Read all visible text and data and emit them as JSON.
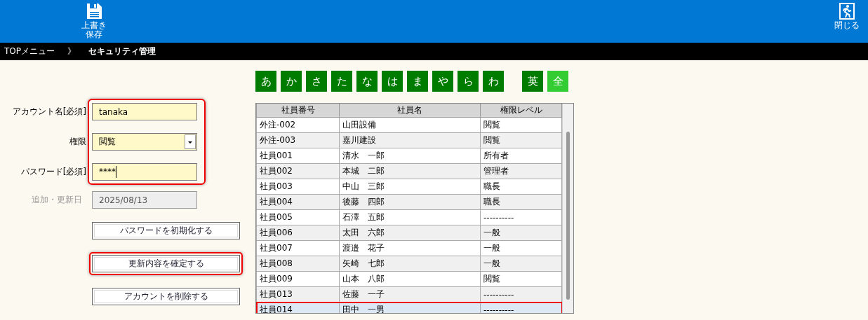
{
  "toolbar": {
    "save_button": {
      "label": "上書き保存"
    },
    "close_button": {
      "label": "閉じる"
    }
  },
  "breadcrumb": {
    "separator": "》",
    "items": [
      {
        "label": "TOPメニュー",
        "current": false
      },
      {
        "label": "セキュリティ管理",
        "current": true
      }
    ]
  },
  "form": {
    "highlighted": true,
    "fields": [
      {
        "label": "アカウント名[必須]",
        "kind": "text",
        "value": "tanaka",
        "disabled": false
      },
      {
        "label": "権限",
        "kind": "select",
        "value": "閲覧",
        "disabled": false
      },
      {
        "label": "パスワード[必須]",
        "kind": "password",
        "value": "****",
        "disabled": false
      }
    ],
    "date_field": {
      "label": "追加・更新日",
      "kind": "text",
      "value": "2025/08/13",
      "disabled": true
    }
  },
  "buttons": [
    {
      "label": "パスワードを初期化する",
      "highlighted": false
    },
    {
      "label": "更新内容を確定する",
      "highlighted": true
    },
    {
      "label": "アカウントを削除する",
      "highlighted": false
    }
  ],
  "kana_filter": [
    {
      "label": "あ",
      "selected": false
    },
    {
      "label": "か",
      "selected": false
    },
    {
      "label": "さ",
      "selected": false
    },
    {
      "label": "た",
      "selected": false
    },
    {
      "label": "な",
      "selected": false
    },
    {
      "label": "は",
      "selected": false
    },
    {
      "label": "ま",
      "selected": false
    },
    {
      "label": "や",
      "selected": false
    },
    {
      "label": "ら",
      "selected": false
    },
    {
      "label": "わ",
      "selected": false
    },
    {
      "label": "英",
      "selected": false
    },
    {
      "label": "全",
      "selected": true
    }
  ],
  "table": {
    "columns": [
      "社員番号",
      "社員名",
      "権限レベル"
    ],
    "rows": [
      {
        "cells": [
          "外注-002",
          "山田設備",
          "閲覧"
        ],
        "selected": false
      },
      {
        "cells": [
          "外注-003",
          "嘉川建設",
          "閲覧"
        ],
        "selected": false
      },
      {
        "cells": [
          "社員001",
          "清水　一郎",
          "所有者"
        ],
        "selected": false
      },
      {
        "cells": [
          "社員002",
          "本城　二郎",
          "管理者"
        ],
        "selected": false
      },
      {
        "cells": [
          "社員003",
          "中山　三郎",
          "職長"
        ],
        "selected": false
      },
      {
        "cells": [
          "社員004",
          "後藤　四郎",
          "職長"
        ],
        "selected": false
      },
      {
        "cells": [
          "社員005",
          "石澤　五郎",
          "----------"
        ],
        "selected": false
      },
      {
        "cells": [
          "社員006",
          "太田　六郎",
          "一般"
        ],
        "selected": false
      },
      {
        "cells": [
          "社員007",
          "渡邉　花子",
          "一般"
        ],
        "selected": false
      },
      {
        "cells": [
          "社員008",
          "矢崎　七郎",
          "一般"
        ],
        "selected": false
      },
      {
        "cells": [
          "社員009",
          "山本　八郎",
          "閲覧"
        ],
        "selected": false
      },
      {
        "cells": [
          "社員013",
          "佐藤　一子",
          "----------"
        ],
        "selected": false
      },
      {
        "cells": [
          "社員014",
          "田中　一男",
          "----------"
        ],
        "selected": true
      }
    ]
  }
}
